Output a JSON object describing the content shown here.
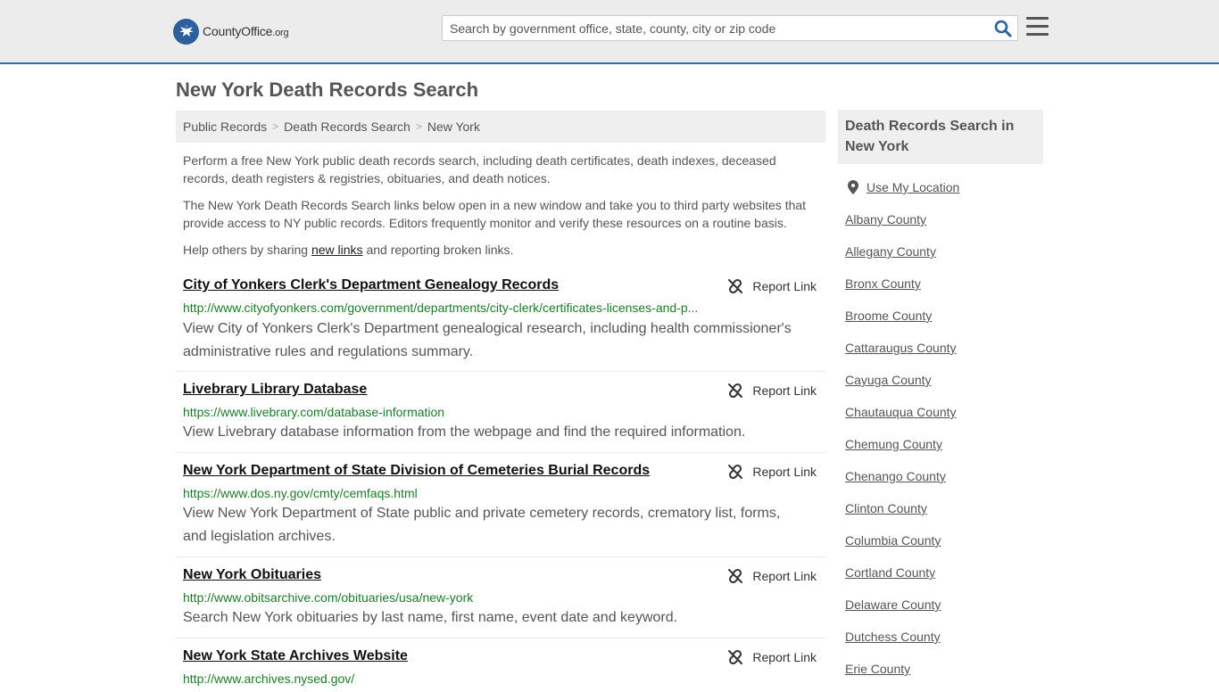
{
  "header": {
    "logo": {
      "brand": "CountyOffice",
      "tld": ".org"
    },
    "search_placeholder": "Search by government office, state, county, city or zip code"
  },
  "page_title": "New York Death Records Search",
  "breadcrumb": [
    {
      "label": "Public Records"
    },
    {
      "label": "Death Records Search"
    },
    {
      "label": "New York"
    }
  ],
  "intro": {
    "p1": "Perform a free New York public death records search, including death certificates, death indexes, deceased records, death registers & registries, obituaries, and death notices.",
    "p2": "The New York Death Records Search links below open in a new window and take you to third party websites that provide access to NY public records. Editors frequently monitor and verify these resources on a routine basis.",
    "p3_before": "Help others by sharing ",
    "p3_link": "new links",
    "p3_after": " and reporting broken links."
  },
  "report_label": "Report Link",
  "records": [
    {
      "title": "City of Yonkers Clerk's Department Genealogy Records",
      "url": "http://www.cityofyonkers.com/government/departments/city-clerk/certificates-licenses-and-p...",
      "desc": "View City of Yonkers Clerk's Department genealogical research, including health commissioner's administrative rules and regulations summary."
    },
    {
      "title": "Livebrary Library Database",
      "url": "https://www.livebrary.com/database-information",
      "desc": "View Livebrary database information from the webpage and find the required information."
    },
    {
      "title": "New York Department of State Division of Cemeteries Burial Records",
      "url": "https://www.dos.ny.gov/cmty/cemfaqs.html",
      "desc": "View New York Department of State public and private cemetery records, crematory list, forms, and legislation archives."
    },
    {
      "title": "New York Obituaries",
      "url": "http://www.obitsarchive.com/obituaries/usa/new-york",
      "desc": "Search New York obituaries by last name, first name, event date and keyword."
    },
    {
      "title": "New York State Archives Website",
      "url": "http://www.archives.nysed.gov/",
      "desc": ""
    }
  ],
  "sidebar": {
    "title": "Death Records Search in New York",
    "use_location": "Use My Location",
    "counties": [
      "Albany County",
      "Allegany County",
      "Bronx County",
      "Broome County",
      "Cattaraugus County",
      "Cayuga County",
      "Chautauqua County",
      "Chemung County",
      "Chenango County",
      "Clinton County",
      "Columbia County",
      "Cortland County",
      "Delaware County",
      "Dutchess County",
      "Erie County"
    ]
  },
  "colors": {
    "header_bg": "#ececec",
    "header_border": "#2f73b5",
    "url_green": "#1d7a2a",
    "search_icon": "#2b5f9e"
  }
}
